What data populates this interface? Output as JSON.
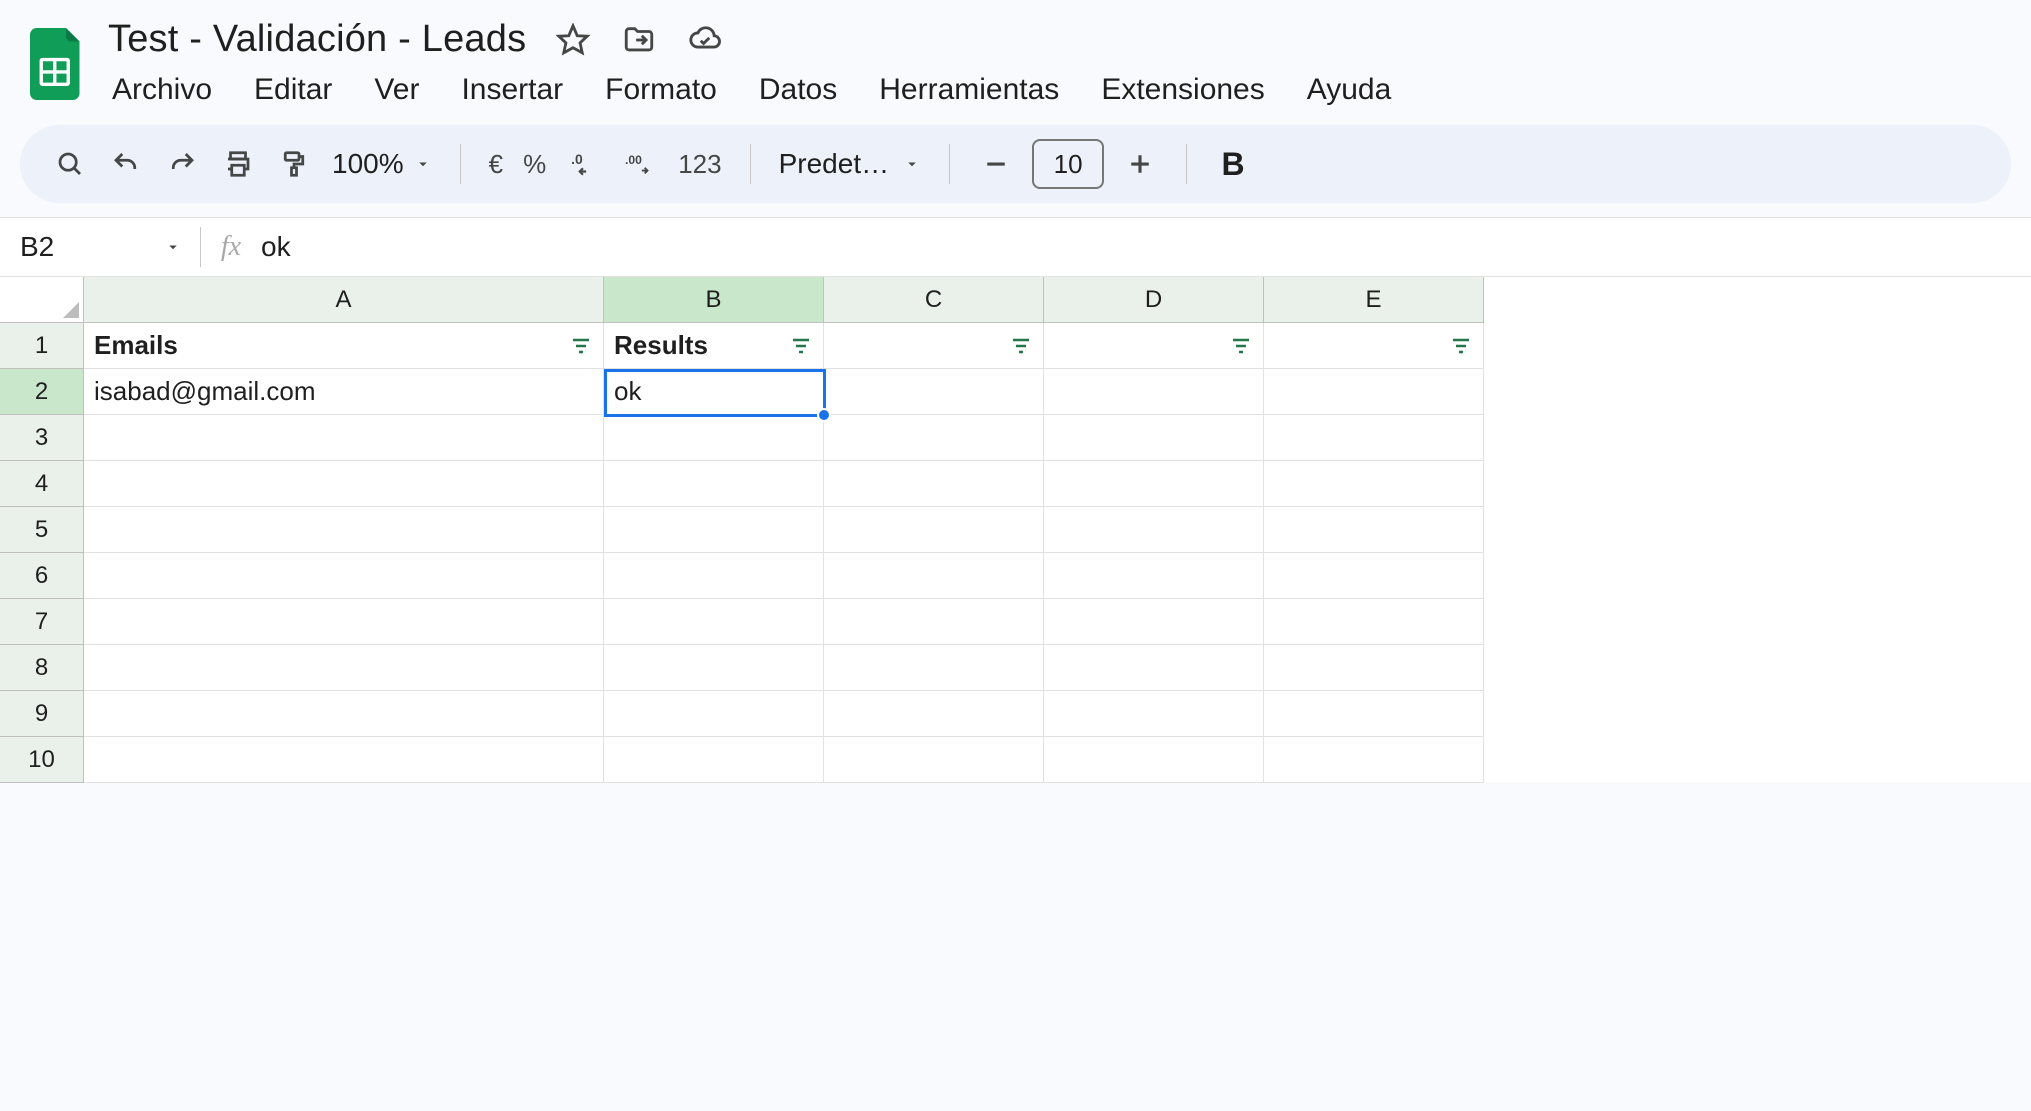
{
  "doc": {
    "title": "Test - Validación - Leads"
  },
  "menubar": {
    "items": [
      "Archivo",
      "Editar",
      "Ver",
      "Insertar",
      "Formato",
      "Datos",
      "Herramientas",
      "Extensiones",
      "Ayuda"
    ]
  },
  "toolbar": {
    "zoom": "100%",
    "currency": "€",
    "percent": "%",
    "numfmt": "123",
    "font": "Predet…",
    "font_size": "10",
    "bold": "B"
  },
  "namebox": {
    "cell_ref": "B2"
  },
  "formula": {
    "value": "ok"
  },
  "columns": [
    "A",
    "B",
    "C",
    "D",
    "E"
  ],
  "rows": [
    "1",
    "2",
    "3",
    "4",
    "5",
    "6",
    "7",
    "8",
    "9",
    "10"
  ],
  "sheet": {
    "A1": "Emails",
    "B1": "Results",
    "A2": "isabad@gmail.com",
    "B2": "ok"
  },
  "selected": {
    "col": "B",
    "row": "2"
  }
}
